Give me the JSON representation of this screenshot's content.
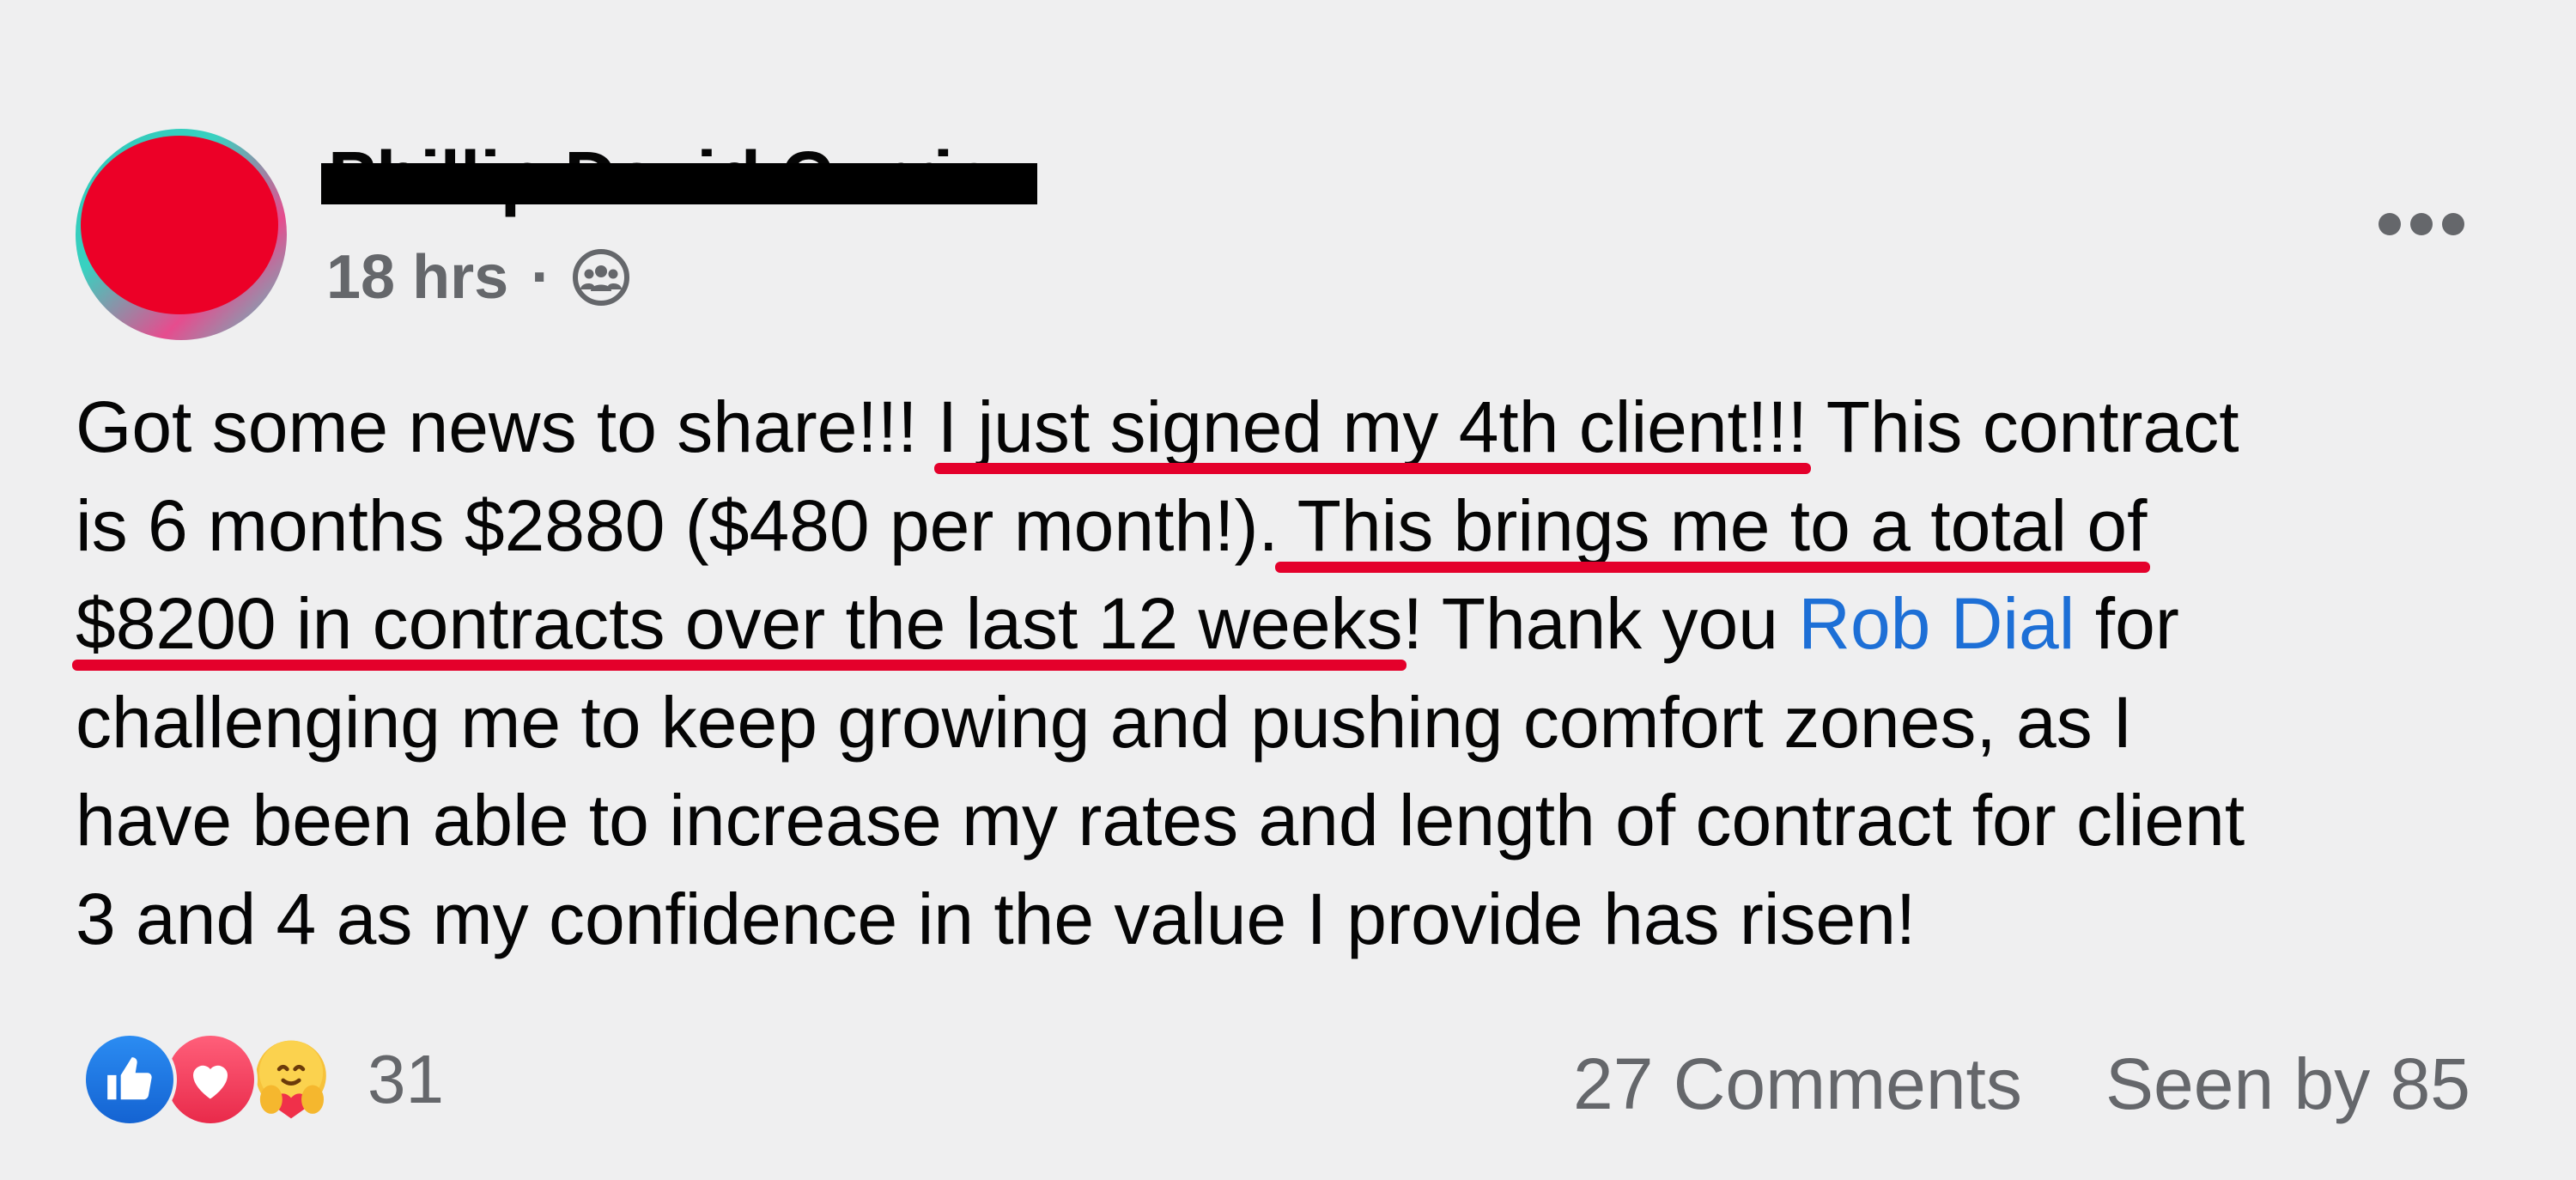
{
  "post": {
    "author_name": "Phillip David Currie",
    "timestamp": "18 hrs",
    "separator": "·",
    "audience_icon": "group-icon",
    "more_icon": "more-options-icon",
    "text_lines": [
      [
        "Got some news to share!!! ",
        "I just signed my 4th client!!!",
        " This contract"
      ],
      [
        "is 6 months $2880 ($480 per month!).",
        " This brings me to a total of"
      ],
      [
        "$8200 in contracts over the last 12 weeks",
        "! Thank you ",
        "Rob Dial",
        " for"
      ],
      [
        "challenging me to keep growing and pushing comfort zones, as I"
      ],
      [
        "have been able to increase my rates and length of contract for client"
      ],
      [
        "3 and 4 as my confidence in the value I provide has risen!"
      ]
    ]
  },
  "footer": {
    "reactions": [
      "like-icon",
      "love-icon",
      "care-icon"
    ],
    "reaction_count": "31",
    "comments": "27 Comments",
    "seen_by": "Seen by 85"
  },
  "colors": {
    "background": "#efeff0",
    "text": "#050505",
    "muted": "#65676b",
    "mention": "#1d6fd6",
    "underline": "#e4002b",
    "redaction": "#ec0027"
  }
}
